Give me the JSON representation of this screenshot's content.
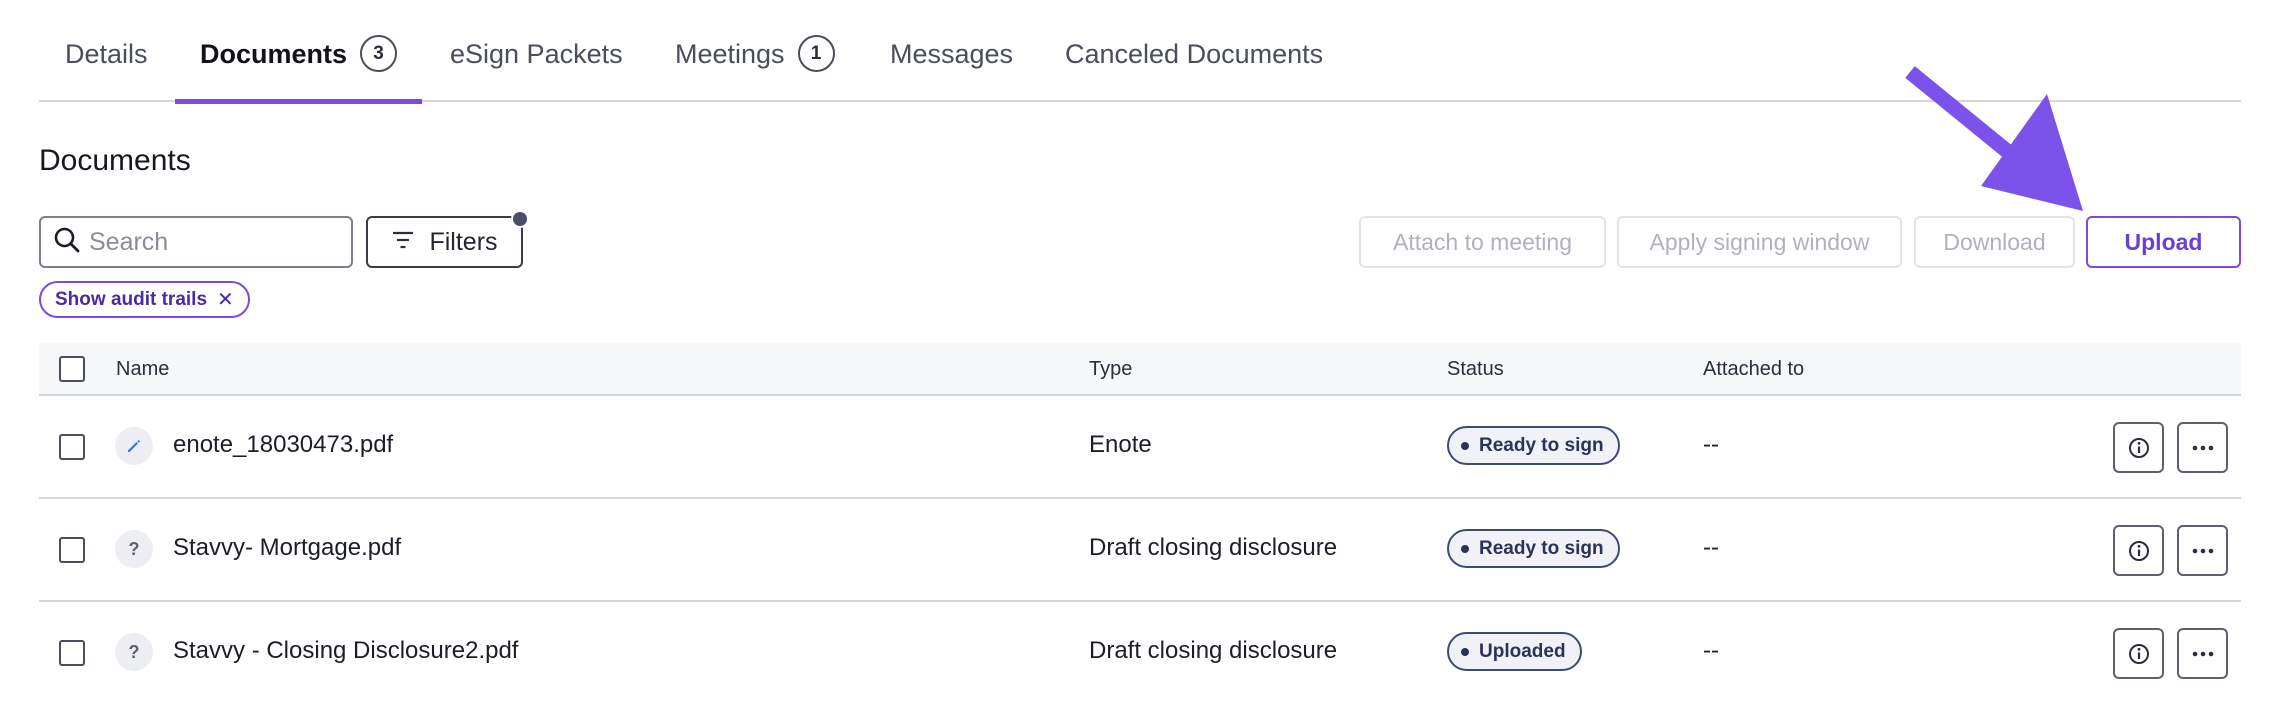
{
  "tabs": [
    {
      "label": "Details"
    },
    {
      "label": "Documents",
      "count": "3"
    },
    {
      "label": "eSign Packets"
    },
    {
      "label": "Meetings",
      "count": "1"
    },
    {
      "label": "Messages"
    },
    {
      "label": "Canceled Documents"
    }
  ],
  "active_tab": "Documents",
  "section_title": "Documents",
  "search": {
    "placeholder": "Search",
    "value": ""
  },
  "filters_label": "Filters",
  "active_filter_chip": "Show audit trails",
  "actions": {
    "attach_to_meeting": "Attach to meeting",
    "apply_signing_window": "Apply signing window",
    "download": "Download",
    "upload": "Upload"
  },
  "table": {
    "columns": [
      "Name",
      "Type",
      "Status",
      "Attached to"
    ],
    "rows": [
      {
        "icon": "pencil-icon",
        "icon_glyph": "",
        "name": "enote_18030473.pdf",
        "type": "Enote",
        "status": "Ready to sign",
        "attached_to": "--"
      },
      {
        "icon": "question-icon",
        "icon_glyph": "?",
        "name": "Stavvy- Mortgage.pdf",
        "type": "Draft closing disclosure",
        "status": "Ready to sign",
        "attached_to": "--"
      },
      {
        "icon": "question-icon",
        "icon_glyph": "?",
        "name": "Stavvy - Closing Disclosure2.pdf",
        "type": "Draft closing disclosure",
        "status": "Uploaded",
        "attached_to": "--"
      }
    ]
  },
  "colors": {
    "accent": "#7c4ae0",
    "arrow": "#7b52ea",
    "badge_border": "#3f4a72"
  }
}
